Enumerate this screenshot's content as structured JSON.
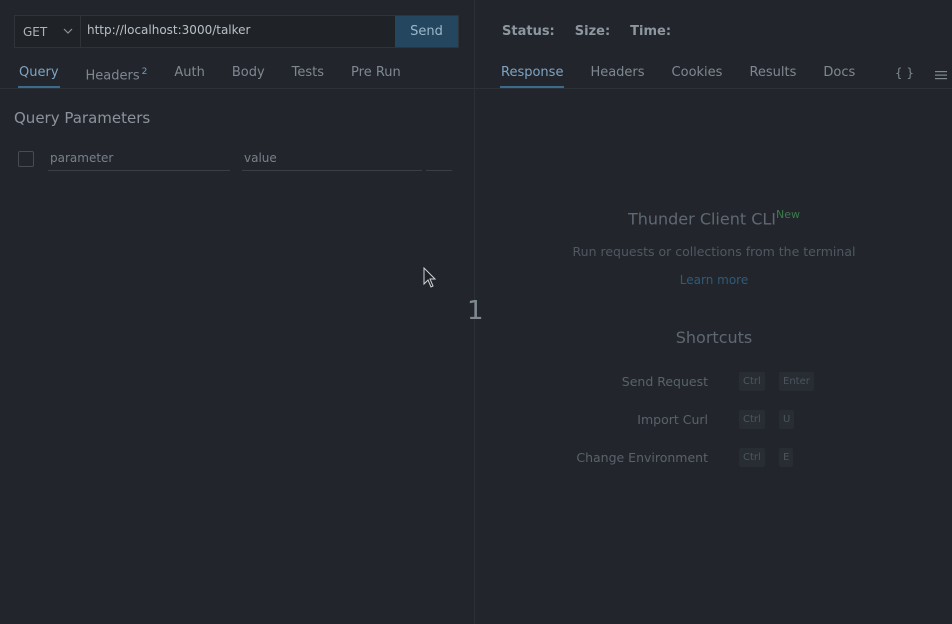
{
  "request": {
    "method": "GET",
    "url": "http://localhost:3000/talker",
    "send_label": "Send"
  },
  "request_tabs": [
    {
      "label": "Query",
      "active": true
    },
    {
      "label": "Headers",
      "badge": "2"
    },
    {
      "label": "Auth"
    },
    {
      "label": "Body"
    },
    {
      "label": "Tests"
    },
    {
      "label": "Pre Run"
    }
  ],
  "query": {
    "title": "Query Parameters",
    "param_placeholder": "parameter",
    "value_placeholder": "value"
  },
  "status": {
    "status_label": "Status:",
    "size_label": "Size:",
    "time_label": "Time:"
  },
  "response_tabs": [
    {
      "label": "Response",
      "active": true
    },
    {
      "label": "Headers"
    },
    {
      "label": "Cookies"
    },
    {
      "label": "Results"
    },
    {
      "label": "Docs"
    }
  ],
  "icons": {
    "braces": "{ }",
    "menu": "hamburger-icon"
  },
  "cli": {
    "title": "Thunder Client CLI",
    "badge": "New",
    "subtitle": "Run requests or collections from the terminal",
    "learn_more": "Learn more"
  },
  "shortcuts": {
    "title": "Shortcuts",
    "items": [
      {
        "label": "Send Request",
        "keys": [
          "Ctrl",
          "Enter"
        ]
      },
      {
        "label": "Import Curl",
        "keys": [
          "Ctrl",
          "U"
        ]
      },
      {
        "label": "Change Environment",
        "keys": [
          "Ctrl",
          "E"
        ]
      }
    ]
  },
  "overlay_number": "1",
  "colors": {
    "background": "#22262c",
    "accent": "#7fa4c2",
    "send_button": "#24465f",
    "new_badge": "#3d7a4e"
  }
}
